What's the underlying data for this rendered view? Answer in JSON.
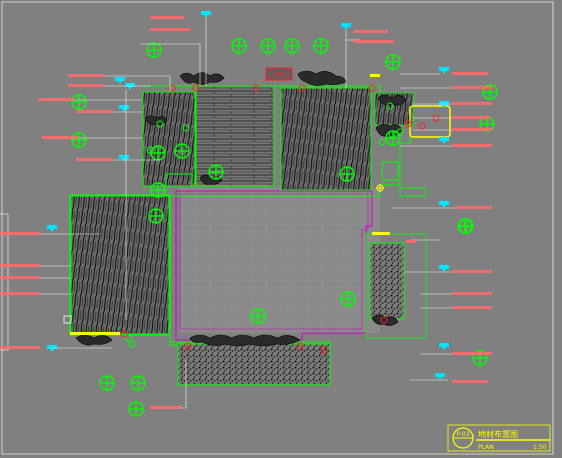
{
  "drawing": {
    "background": "#808080",
    "colors": {
      "green": "#00ff00",
      "magenta": "#d000d0",
      "red": "#ff2020",
      "cyan": "#00e5ff",
      "yellow": "#ffff00",
      "white": "#ffffff",
      "black": "#000000",
      "darkgray": "#5a5a5a"
    }
  },
  "title_block": {
    "sheet_no": "P-03",
    "title": "地材布置图",
    "subtitle": "PLAN",
    "scale": "1:50"
  }
}
